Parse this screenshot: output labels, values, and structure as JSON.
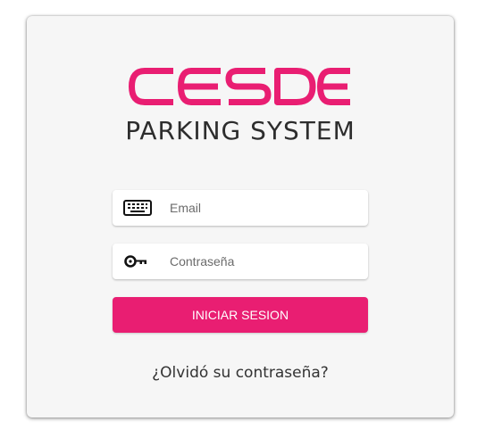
{
  "brand": {
    "logo_text": "CESDE",
    "subtitle": "PARKING SYSTEM",
    "accent_color": "#e91e72"
  },
  "login": {
    "email_placeholder": "Email",
    "email_icon": "keyboard-icon",
    "password_placeholder": "Contraseña",
    "password_icon": "key-icon",
    "submit_label": "INICIAR SESION",
    "forgot_label": "¿Olvidó su contraseña?"
  }
}
